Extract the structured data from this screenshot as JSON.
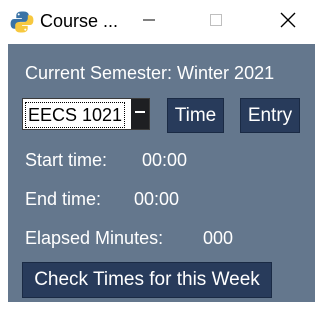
{
  "window": {
    "title": "Course ...",
    "app_icon": "python-icon",
    "controls": [
      "minimize-icon",
      "maximize-icon",
      "close-icon"
    ]
  },
  "semester": {
    "label": "Current Semester: Winter 2021"
  },
  "course_select": {
    "value": "EECS 1021",
    "arrow_icon": "chevron-down-icon"
  },
  "buttons": {
    "time": "Time",
    "entry": "Entry",
    "check": "Check Times for this Week"
  },
  "times": {
    "start_label": "Start time:",
    "start_value": "00:00",
    "end_label": "End time:",
    "end_value": "00:00",
    "elapsed_label": "Elapsed Minutes:",
    "elapsed_value": "000"
  },
  "colors": {
    "background": "#64778d",
    "button": "#283b5b",
    "text": "#ffffff"
  }
}
